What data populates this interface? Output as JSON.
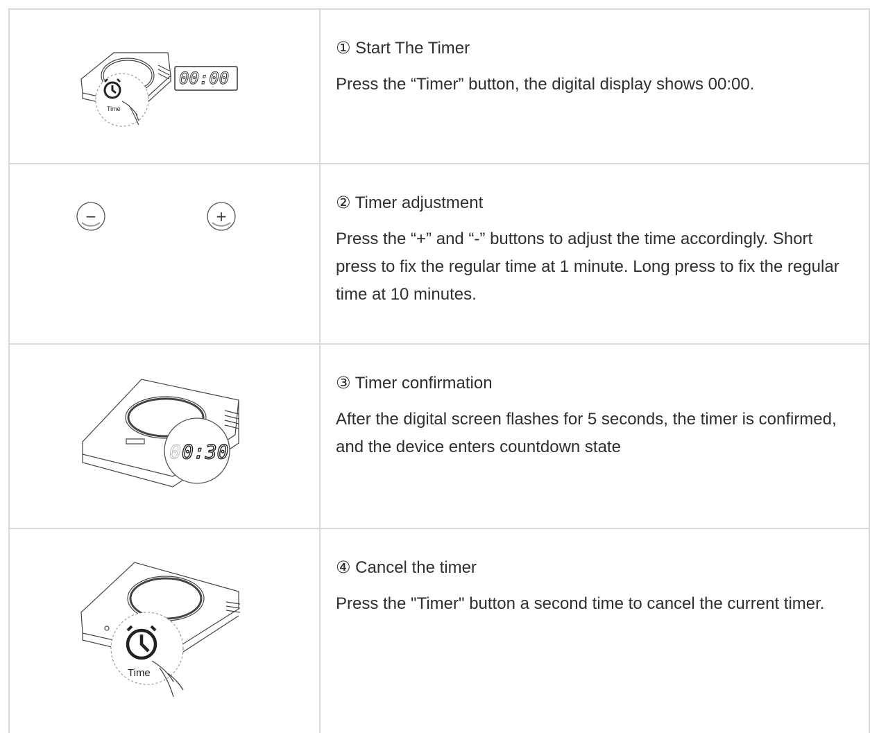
{
  "steps": [
    {
      "title": "① Start The Timer",
      "body": "Press the “Timer” button, the digital display shows 00:00.",
      "image": {
        "display": "00:00",
        "button_label": "Time"
      }
    },
    {
      "title": "② Timer adjustment",
      "body": "Press the “+” and “-” buttons to adjust the time accordingly. Short press to fix the regular time at 1 minute. Long press to fix the regular time at 10 minutes.",
      "image": {
        "minus_label": "−",
        "plus_label": "+"
      }
    },
    {
      "title": "③ Timer confirmation",
      "body": "After the digital screen flashes for 5 seconds, the timer is confirmed, and the device enters countdown state",
      "image": {
        "display_dim": "0",
        "display": "0:30"
      }
    },
    {
      "title": "④ Cancel the timer",
      "body": "Press the \"Timer\" button a second time to cancel the current timer.",
      "image": {
        "button_label": "Time"
      }
    }
  ]
}
